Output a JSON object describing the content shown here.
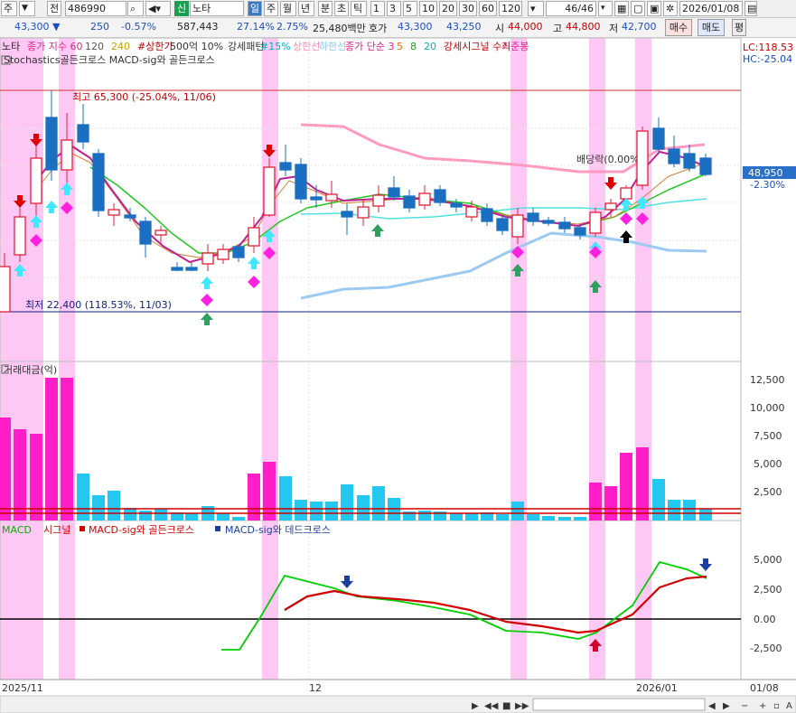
{
  "toolbar": {
    "market": "주",
    "prev": "전",
    "code": "486990",
    "badge": "신",
    "name": "노타",
    "periods": [
      "일",
      "주",
      "월",
      "년",
      "분",
      "초",
      "틱"
    ],
    "intervals": [
      "1",
      "3",
      "5",
      "10",
      "20",
      "30",
      "60",
      "120"
    ],
    "page": "46/46",
    "date": "2026/01/08"
  },
  "info": {
    "price": "43,300 ▼",
    "change": "250",
    "rate": "-0.57%",
    "volume": "587,443",
    "turnover": "27.14%",
    "vol_rate": "2.75%",
    "amount": "25,480백만",
    "ask_label": "호가",
    "ask": "43,300",
    "bid": "43,250",
    "open_label": "시",
    "open": "44,000",
    "high_label": "고",
    "high": "44,800",
    "low_label": "저",
    "low": "42,700",
    "buy": "매수",
    "sell": "매도",
    "flat": "평"
  },
  "legend1": [
    {
      "t": "노타",
      "c": "#222"
    },
    {
      "t": "종가 지수 60",
      "c": "#e0208a"
    },
    {
      "t": "120",
      "c": "#555"
    },
    {
      "t": "240",
      "c": "#c8a000"
    },
    {
      "t": "#상한가",
      "c": "#c00000"
    },
    {
      "t": "500억 10%",
      "c": "#333"
    },
    {
      "t": "강세패턴",
      "c": "#333"
    },
    {
      "t": "#15%",
      "c": "#00b0c0"
    },
    {
      "t": "상한선",
      "c": "#ff8ab0"
    },
    {
      "t": "하한선",
      "c": "#90c8f0"
    },
    {
      "t": "종가 단순 3",
      "c": "#e0208a"
    },
    {
      "t": "5",
      "c": "#e07000"
    },
    {
      "t": "8",
      "c": "#00b000"
    },
    {
      "t": "20",
      "c": "#00b0c0"
    },
    {
      "t": "강세시그널 수식",
      "c": "#c00000"
    },
    {
      "t": "기준봉",
      "c": "#e0208a"
    }
  ],
  "legend2": "Stochastics골든크로스  MACD-sig와 골든크로스",
  "price_axis": {
    "lc": "LC:118.53",
    "hc": "HC:-25.04",
    "current": "48,950",
    "current_rate": "-2.30%"
  },
  "annotations": {
    "max": "최고 65,300 (-25.04%, 11/06)",
    "min": "최저 22,400 (118.53%, 11/03)",
    "dividend": "배당락(0.00%)"
  },
  "volume_panel": {
    "title": "거래대금(억)",
    "ticks": [
      "12,500",
      "10,000",
      "7,500",
      "5,000",
      "2,500"
    ]
  },
  "macd_panel": {
    "labels": [
      "MACD",
      "시그널",
      "MACD-sig와 골든크로스",
      "MACD-sig와 데드크로스"
    ],
    "ticks": [
      "5,000",
      "2,500",
      "0.00",
      "-2,500"
    ]
  },
  "xaxis": [
    "2025/11",
    "12",
    "2026/01",
    "01/08"
  ],
  "colors": {
    "up": "#e0203a",
    "down": "#1a6fc0",
    "highlight": "#ffc8f4",
    "macd": "#00d000",
    "signal": "#d00000"
  }
}
